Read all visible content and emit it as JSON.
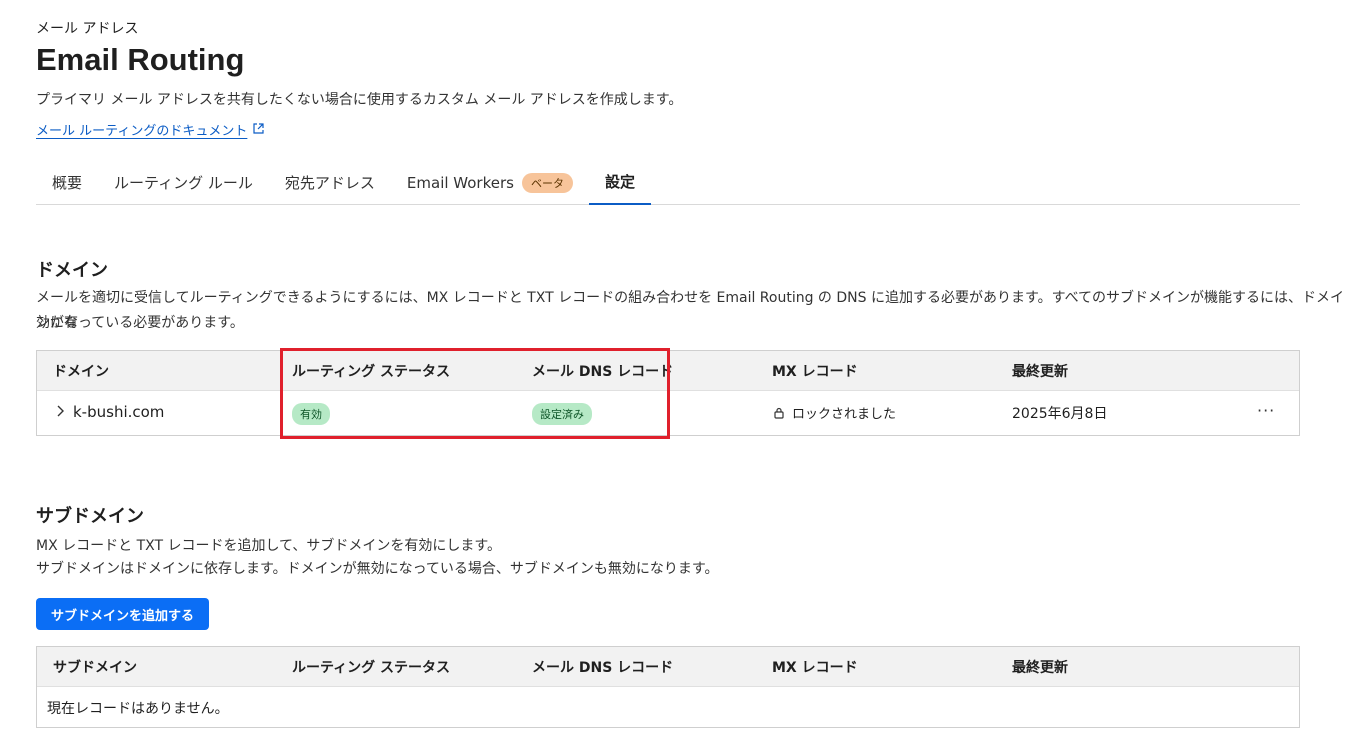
{
  "breadcrumb": "メール アドレス",
  "page_title": "Email Routing",
  "subtitle": "プライマリ メール アドレスを共有したくない場合に使用するカスタム メール アドレスを作成します。",
  "doc_link": "メール ルーティングのドキュメント",
  "tabs": [
    {
      "label": "概要"
    },
    {
      "label": "ルーティング ルール"
    },
    {
      "label": "宛先アドレス"
    },
    {
      "label": "Email Workers",
      "badge": "ベータ"
    },
    {
      "label": "設定",
      "active": true
    }
  ],
  "domain_section": {
    "title": "ドメイン",
    "description_line1": "メールを適切に受信してルーティングできるようにするには、MX レコードと TXT レコードの組み合わせを Email Routing の DNS に追加する必要があります。すべてのサブドメインが機能するには、ドメインが有",
    "description_line2": "効になっている必要があります。",
    "columns": [
      "ドメイン",
      "ルーティング ステータス",
      "メール DNS レコード",
      "MX レコード",
      "最終更新"
    ],
    "rows": [
      {
        "domain": "k-bushi.com",
        "routing_status": "有効",
        "dns_record": "設定済み",
        "mx_record": "ロックされました",
        "last_updated": "2025年6月8日"
      }
    ],
    "more_glyph": "···"
  },
  "subdomain_section": {
    "title": "サブドメイン",
    "description_line1": "MX レコードと TXT レコードを追加して、サブドメインを有効にします。",
    "description_line2": "サブドメインはドメインに依存します。ドメインが無効になっている場合、サブドメインも無効になります。",
    "add_button": "サブドメインを追加する",
    "columns": [
      "サブドメイン",
      "ルーティング ステータス",
      "メール DNS レコード",
      "MX レコード",
      "最終更新"
    ],
    "empty_text": "現在レコードはありません。"
  },
  "colors": {
    "accent": "#0b6ef5",
    "link": "#0b5cc5",
    "status_pill": "#b6e9c6",
    "beta_badge": "#f7c49a",
    "highlight": "#e0202c"
  }
}
